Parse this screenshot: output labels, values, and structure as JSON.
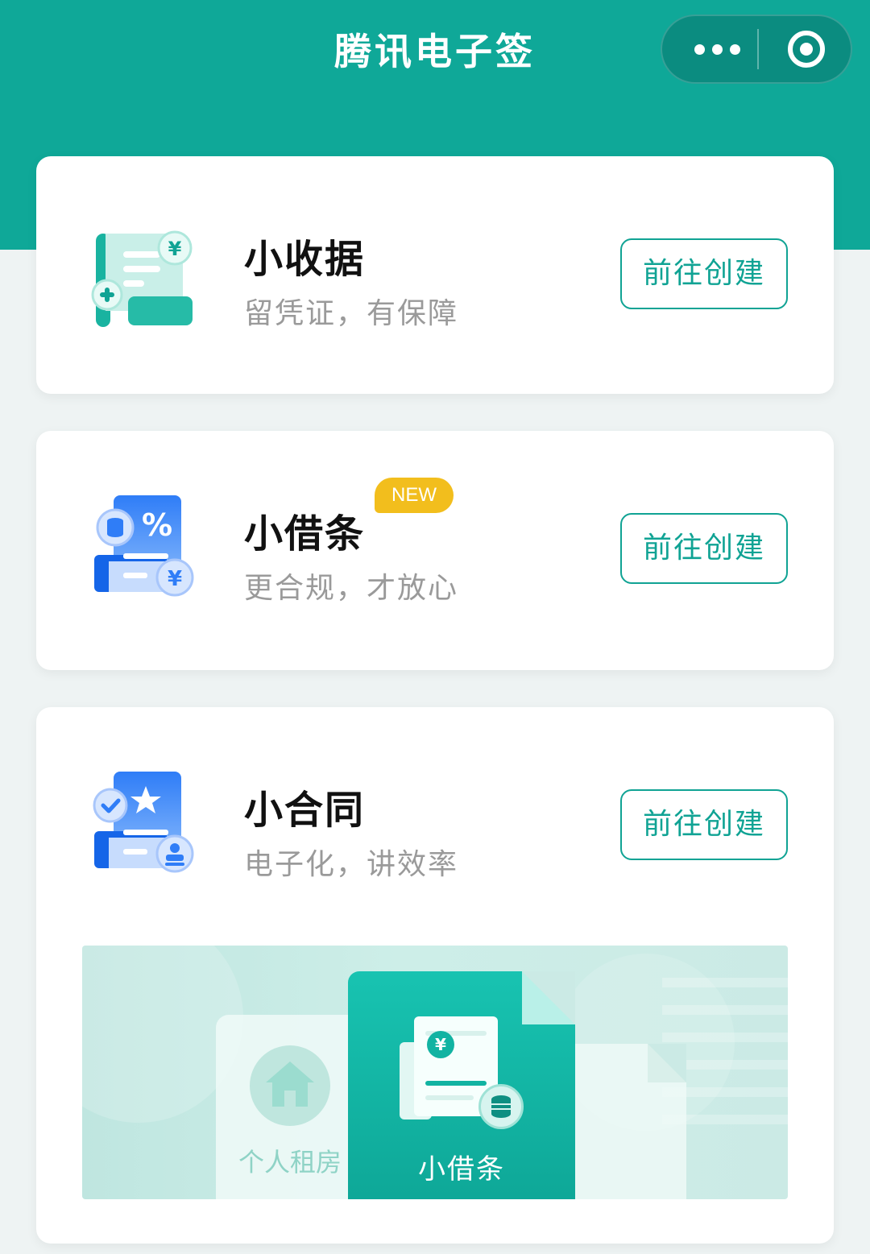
{
  "app": {
    "title": "腾讯电子签"
  },
  "capsule": {
    "more_icon": "more-dots-icon",
    "close_icon": "target-close-icon"
  },
  "colors": {
    "brand": "#0fa898",
    "button_border": "#10a394",
    "badge": "#f2be1d"
  },
  "cards": [
    {
      "title": "小收据",
      "subtitle": "留凭证，有保障",
      "button": "前往创建",
      "icon": "receipt-icon"
    },
    {
      "title": "小借条",
      "subtitle": "更合规，才放心",
      "button": "前往创建",
      "badge": "NEW",
      "icon": "iou-icon"
    },
    {
      "title": "小合同",
      "subtitle": "电子化，讲效率",
      "button": "前往创建",
      "icon": "contract-icon"
    }
  ],
  "banner": {
    "left_label": "个人租房",
    "center_label": "小借条",
    "yen_symbol": "¥"
  }
}
